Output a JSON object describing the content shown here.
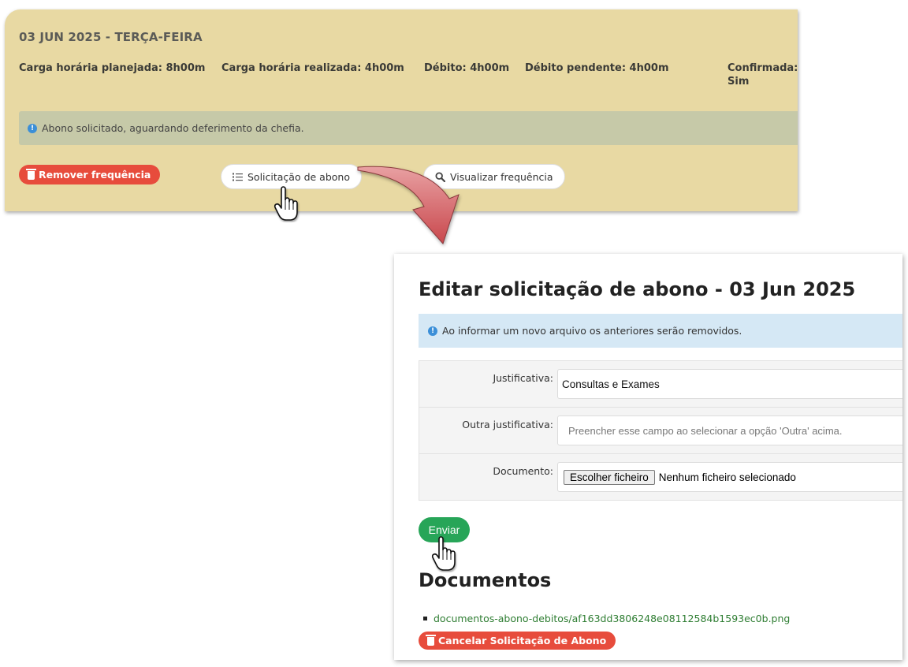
{
  "day_card": {
    "date_title": "03 JUN 2025 - TERÇA-FEIRA",
    "planned_hours": "Carga horária planejada: 8h00m",
    "worked_hours": "Carga horária realizada: 4h00m",
    "debit": "Débito: 4h00m",
    "pending_debit": "Débito pendente: 4h00m",
    "confirmed_label": "Confirmada:",
    "confirmed_value": "Sim",
    "alert_text": "Abono solicitado, aguardando deferimento da chefia.",
    "remove_button": "Remover frequência",
    "request_button": "Solicitação de abono",
    "view_button": "Visualizar frequência"
  },
  "edit_form": {
    "title": "Editar solicitação de abono - 03 Jun 2025",
    "note": "Ao informar um novo arquivo os anteriores serão removidos.",
    "justification_label": "Justificativa:",
    "justification_value": "Consultas e Exames",
    "other_label": "Outra justificativa:",
    "other_placeholder": "Preencher esse campo ao selecionar a opção 'Outra' acima.",
    "document_label": "Documento:",
    "file_button": "Escolher ficheiro",
    "file_status": "Nenhum ficheiro selecionado",
    "submit_button": "Enviar"
  },
  "documents": {
    "title": "Documentos",
    "items": [
      "documentos-abono-debitos/af163dd3806248e08112584b1593ec0b.png"
    ],
    "cancel_button": "Cancelar Solicitação de Abono"
  },
  "colors": {
    "card_bg": "#e8d9a3",
    "danger": "#e74c3c",
    "success": "#27a558",
    "info_bar": "#d5e8f5",
    "arrow": "#d9777a"
  },
  "icons": [
    "info-icon",
    "trash-icon",
    "list-icon",
    "search-icon",
    "hand-pointer-icon",
    "curved-arrow-icon"
  ]
}
